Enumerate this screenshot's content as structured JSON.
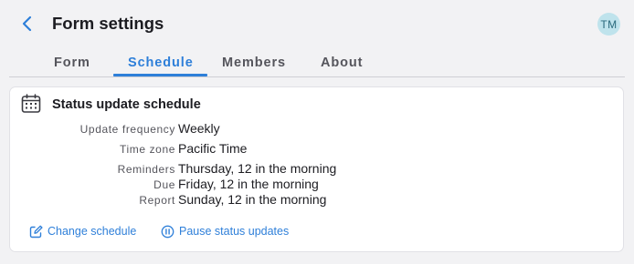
{
  "header": {
    "title": "Form settings",
    "avatar_initials": "TM",
    "back_icon": "chevron-left-icon"
  },
  "tabs": [
    {
      "label": "Form",
      "active": false
    },
    {
      "label": "Schedule",
      "active": true
    },
    {
      "label": "Members",
      "active": false
    },
    {
      "label": "About",
      "active": false
    }
  ],
  "schedule": {
    "icon": "calendar-icon",
    "title": "Status update schedule",
    "fields": [
      {
        "label": "Update frequency",
        "value": "Weekly"
      },
      {
        "label": "Time zone",
        "value": "Pacific Time"
      },
      {
        "label": "Reminders",
        "value": "Thursday, 12 in the morning"
      },
      {
        "label": "Due",
        "value": "Friday, 12 in the morning"
      },
      {
        "label": "Report",
        "value": "Sunday, 12 in the morning"
      }
    ],
    "actions": {
      "change": {
        "label": "Change schedule",
        "icon": "edit-icon"
      },
      "pause": {
        "label": "Pause status updates",
        "icon": "pause-circle-icon"
      }
    }
  },
  "colors": {
    "accent": "#2e7fd9",
    "background": "#f2f2f4",
    "avatar_bg": "#bfe3ec"
  }
}
